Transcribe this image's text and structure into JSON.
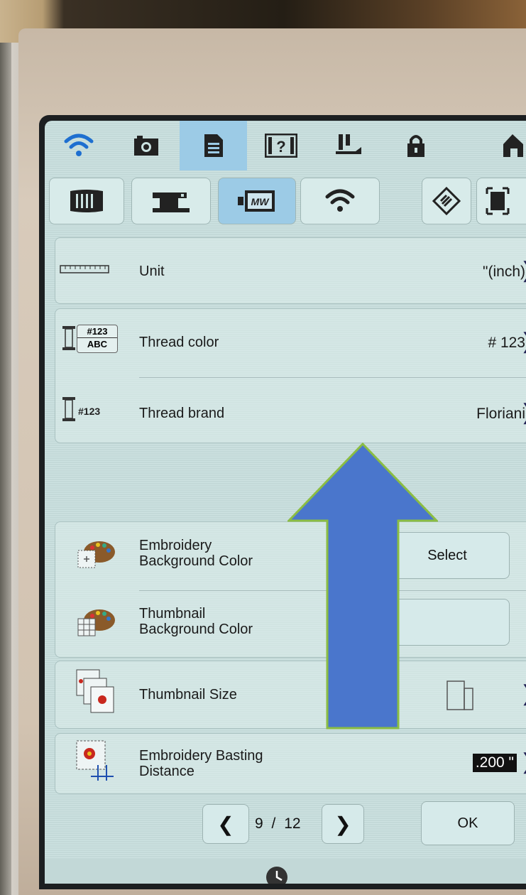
{
  "top_tabs": [
    {
      "icon": "wifi-icon"
    },
    {
      "icon": "camera-icon"
    },
    {
      "icon": "document-icon"
    },
    {
      "icon": "help-icon"
    },
    {
      "icon": "presser-foot-icon"
    },
    {
      "icon": "lock-icon"
    },
    {
      "icon": "home-icon"
    }
  ],
  "sub_tabs": [
    {
      "icon": "machine-settings-icon"
    },
    {
      "icon": "sewing-machine-icon"
    },
    {
      "icon": "embroidery-icon"
    },
    {
      "icon": "wifi-icon"
    },
    {
      "icon": "eco-mode-icon"
    },
    {
      "icon": "screen-icon"
    }
  ],
  "settings": {
    "unit": {
      "label": "Unit",
      "value": "\"(inch)"
    },
    "thread_color": {
      "label": "Thread color",
      "value": "# 123",
      "icon_text_top": "#123",
      "icon_text_bottom": "ABC"
    },
    "thread_brand": {
      "label": "Thread brand",
      "value": "Floriani",
      "icon_text": "#123"
    },
    "embroidery_bg": {
      "label_line1": "Embroidery",
      "label_line2": "Background Color",
      "button": "Select"
    },
    "thumbnail_bg": {
      "label_line1": "Thumbnail",
      "label_line2": "Background Color"
    },
    "thumbnail_size": {
      "label": "Thumbnail Size"
    },
    "basting": {
      "label_line1": "Embroidery Basting",
      "label_line2": "Distance",
      "value": ".200 \""
    }
  },
  "pager": {
    "current": "9",
    "separator": "/",
    "total": "12"
  },
  "ok_label": "OK",
  "colors": {
    "screen_bg": "#cbe2e1",
    "active_tab": "#9ccbe6",
    "annotation_arrow": "#4a76cc"
  }
}
